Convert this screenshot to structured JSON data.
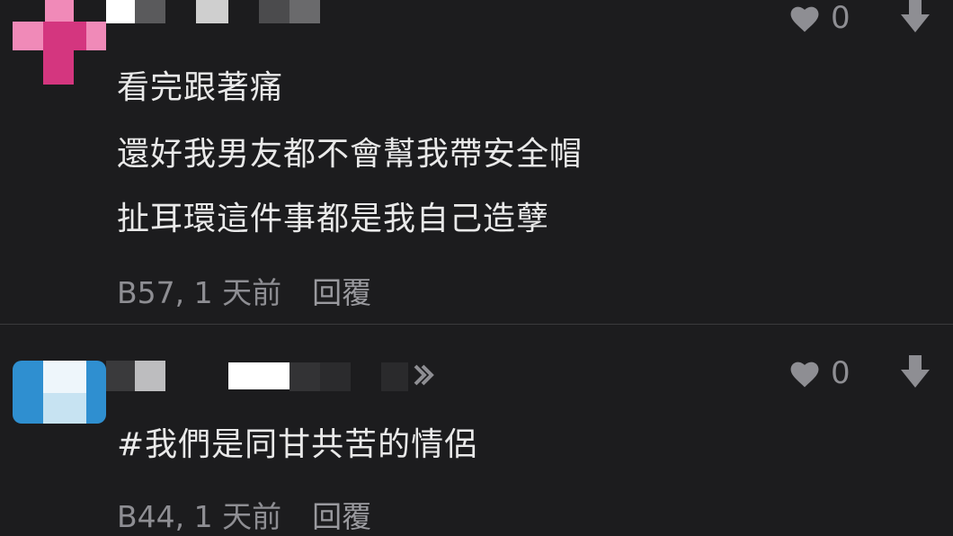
{
  "comments": [
    {
      "lines": [
        "看完跟著痛",
        "還好我男友都不會幫我帶安全帽",
        "扯耳環這件事都是我自己造孽"
      ],
      "floor_time": "B57, 1 天前",
      "reply_label": "回覆",
      "like_count": "0",
      "avatar_colors": [
        "#f08ab8",
        "#d4367f"
      ]
    },
    {
      "lines": [
        "#我們是同甘共苦的情侶"
      ],
      "floor_time": "B44, 1 天前",
      "reply_label": "回覆",
      "like_count": "0",
      "avatar_colors": [
        "#2f8fd0",
        "#c7e3f2"
      ]
    }
  ],
  "icons": {
    "like": "heart-icon",
    "dislike": "arrow-down-icon"
  },
  "colors": {
    "background": "#1c1c1e",
    "text": "#e9e9e9",
    "meta": "#8e8e93",
    "divider": "#3a3a3c"
  }
}
